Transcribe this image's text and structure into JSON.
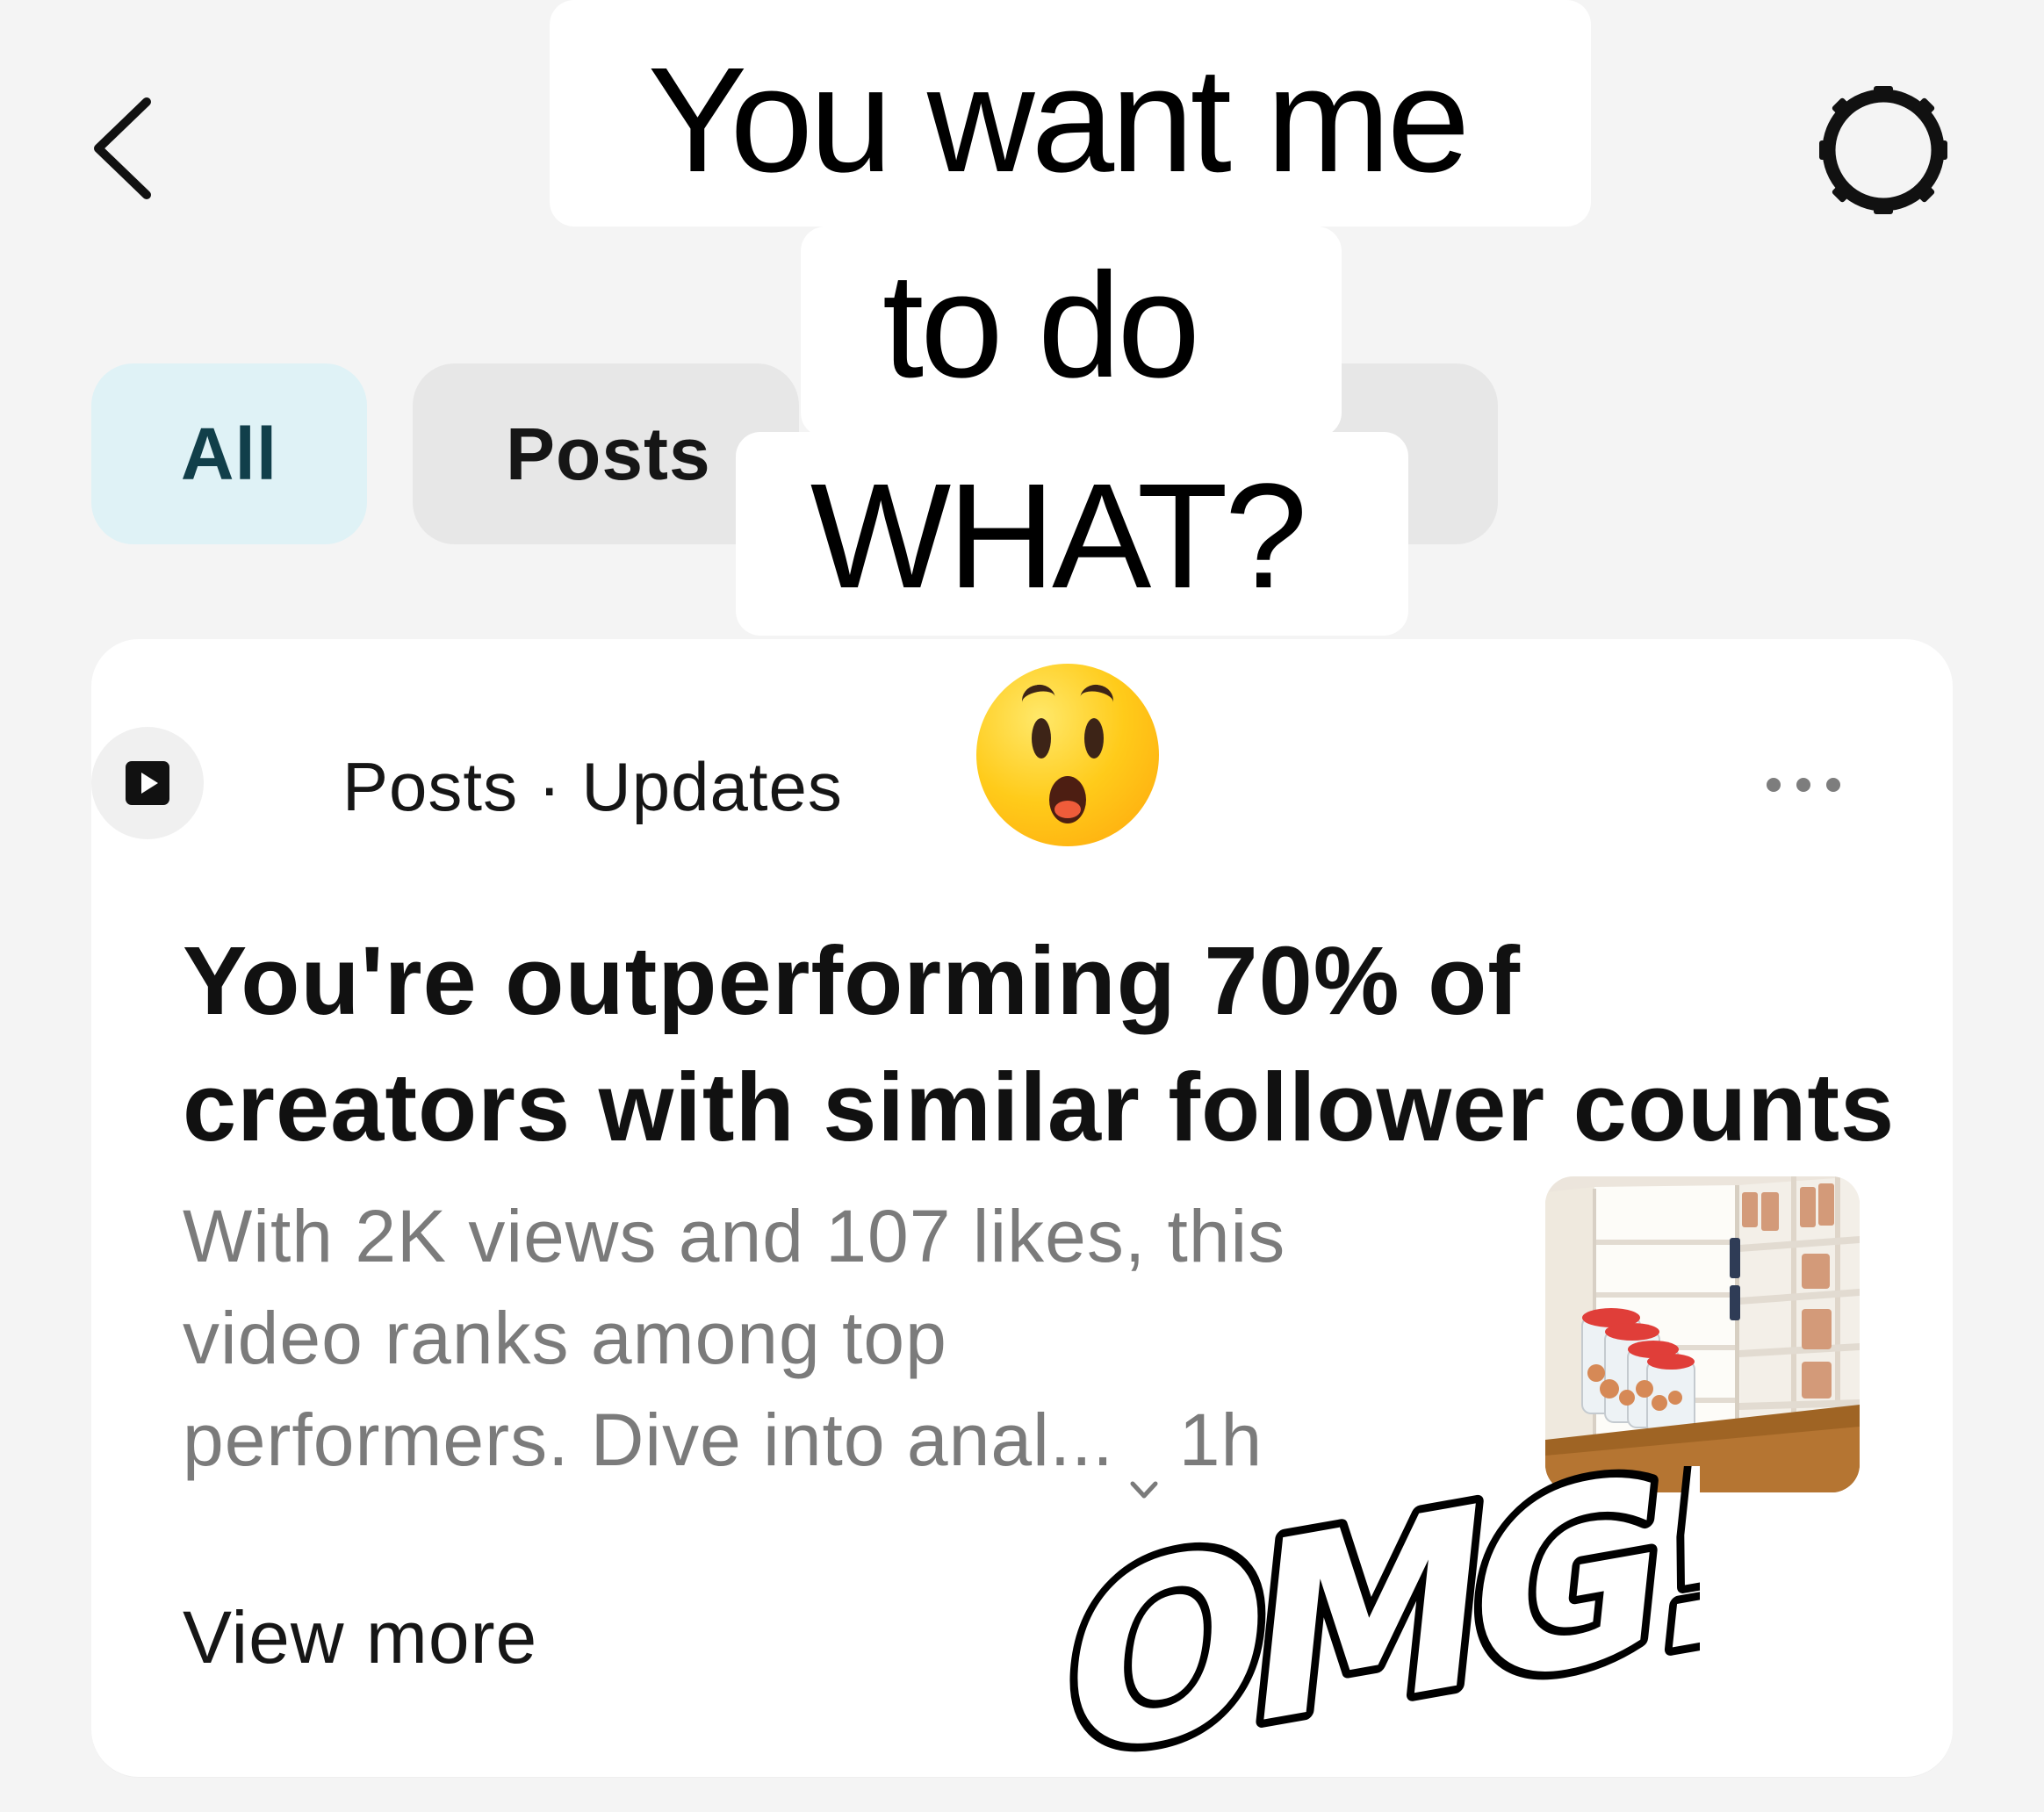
{
  "header": {
    "back_icon": "chevron-left-icon",
    "settings_icon": "gear-icon"
  },
  "tabs": [
    {
      "label": "All",
      "active": true
    },
    {
      "label": "Posts",
      "active": false
    }
  ],
  "caption": {
    "lines": [
      "You want me",
      "to do",
      "WHAT?"
    ]
  },
  "notification": {
    "source_icon": "video-play-icon",
    "source": "Posts · Updates",
    "title_lines": [
      "You're outperforming 70% of",
      "creators with similar follower counts"
    ],
    "body_lines": [
      "With 2K views and 107 likes, this",
      "video ranks among top",
      "performers. Dive into anal..."
    ],
    "time": "1h",
    "view_more": "View more",
    "more_icon": "more-dots-icon"
  },
  "overlay": {
    "emoji": "astonished-emoji-icon",
    "sticker_text": "OMG!"
  },
  "colors": {
    "background": "#f4f4f4",
    "card": "#ffffff",
    "active_tab_bg": "#dff2f6",
    "active_tab_text": "#113f4a",
    "inactive_tab_bg": "#e7e7e7",
    "muted_text": "#7b7b7b"
  }
}
